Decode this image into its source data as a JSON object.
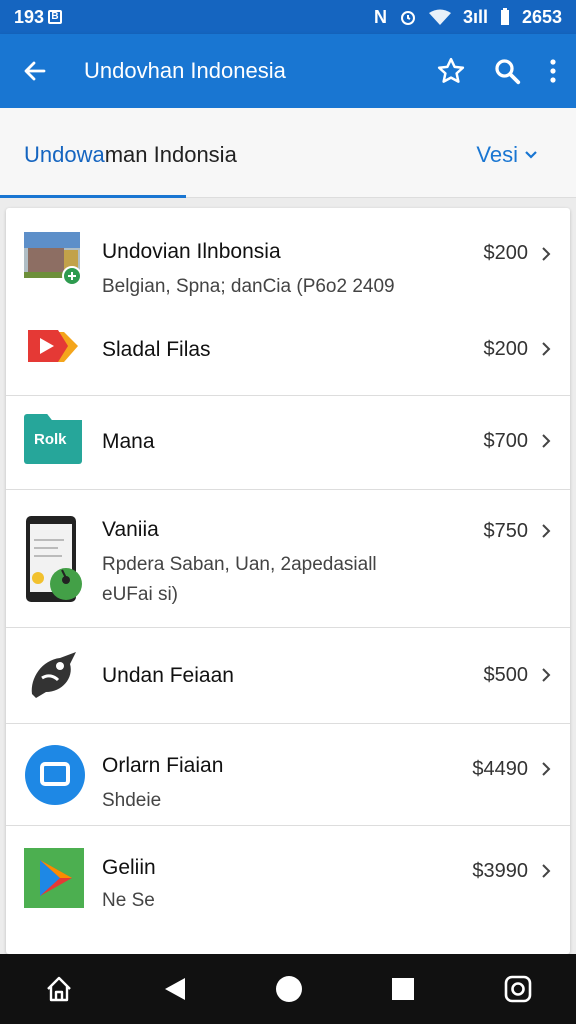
{
  "status_bar": {
    "time": "193",
    "right_text": "2653",
    "signal_text": "3ıll"
  },
  "app_bar": {
    "title": "Undovhan Indonesia"
  },
  "tab": {
    "primary_blue": "Undowa",
    "primary_dark": "man Indonsia",
    "sort_label": "Vesi"
  },
  "items": [
    {
      "title": "Undovian Ilnbonsia",
      "subtitle": "Belgian, Spna; danCia (P6o2 2409",
      "price": "$200",
      "icon": "store-photo-icon"
    },
    {
      "title": "Sladal Filas",
      "subtitle": "",
      "price": "$200",
      "icon": "red-play-icon"
    },
    {
      "title": "Mana",
      "subtitle": "",
      "price": "$700",
      "icon": "teal-folder-icon",
      "icon_text": "Rolk"
    },
    {
      "title": "Vaniia",
      "subtitle": "Rpdera Saban, Uan, 2apedasiall",
      "subtitle2": "eUFai si)",
      "price": "$750",
      "icon": "phone-icon"
    },
    {
      "title": "Undan Feiaan",
      "subtitle": "",
      "price": "$500",
      "icon": "bird-icon"
    },
    {
      "title": "Orlarn Fiaian",
      "subtitle": "Shdeie",
      "price": "$4490",
      "icon": "blue-circle-icon"
    },
    {
      "title": "Geliin",
      "subtitle": "Ne Se",
      "price": "$3990",
      "icon": "green-play-icon"
    }
  ],
  "colors": {
    "primary": "#1976d2",
    "status": "#1565c0",
    "nav": "#111111"
  }
}
